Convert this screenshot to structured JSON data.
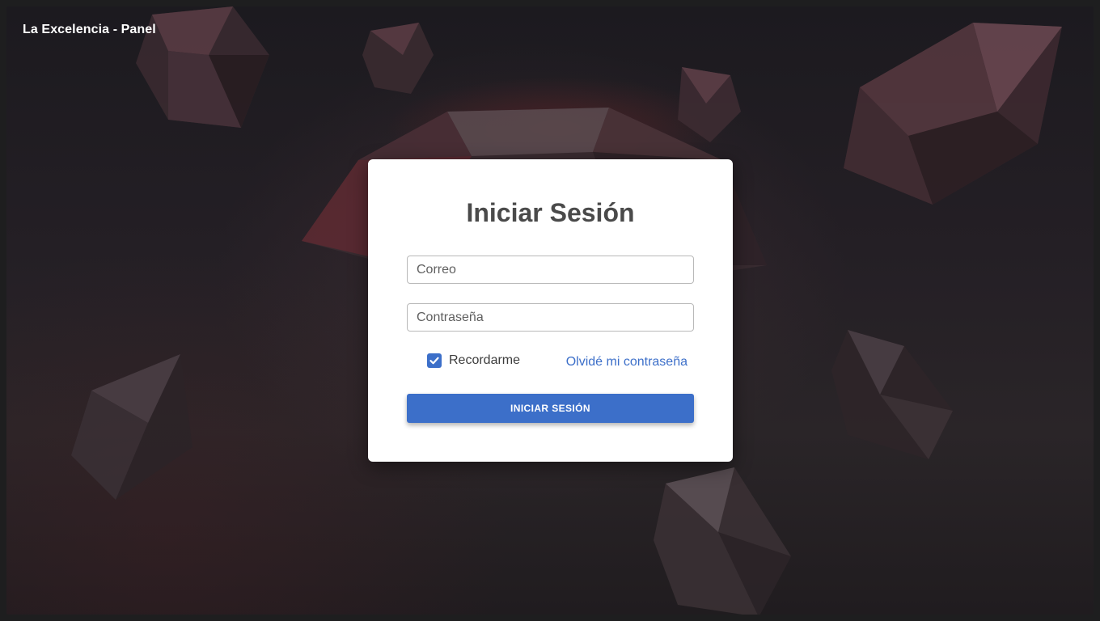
{
  "app": {
    "title": "La Excelencia - Panel"
  },
  "login": {
    "title": "Iniciar Sesión",
    "email_placeholder": "Correo",
    "password_placeholder": "Contraseña",
    "remember_label": "Recordarme",
    "remember_checked": true,
    "forgot_link": "Olvidé mi contraseña",
    "submit_label": "INICIAR SESIÓN"
  },
  "colors": {
    "accent": "#3c6fc9",
    "card_background": "#ffffff",
    "title_text": "#4a4a4a"
  },
  "icons": {
    "checkbox": "check-icon"
  }
}
